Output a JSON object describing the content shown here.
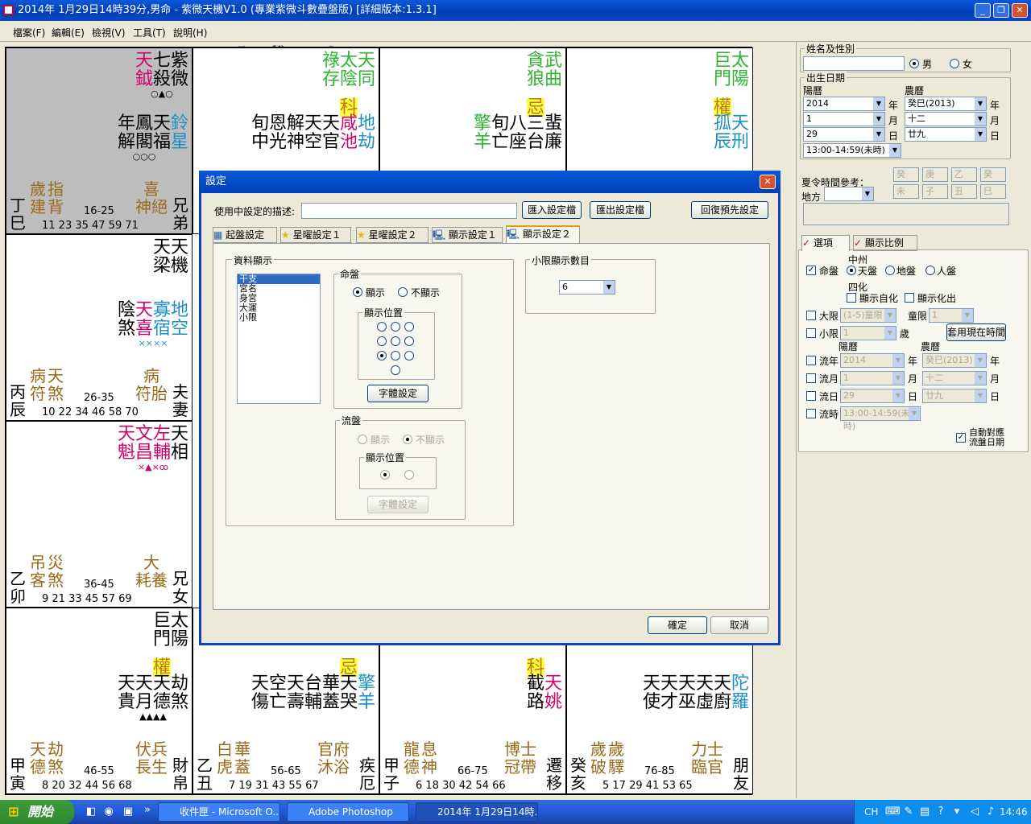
{
  "window": {
    "title": "2014年 1月29日14時39分,男命 - 紫微天機V1.0 (專業紫微斗數疊盤版) [詳細版本:1.3.1]"
  },
  "menu": [
    "檔案(F)",
    "編輯(E)",
    "檢視(V)",
    "工具(T)",
    "說明(H)"
  ],
  "palaces": [
    {
      "id": "si",
      "stem": "丁巳",
      "palace": "兄弟",
      "age": "16-25",
      "years": "11 23 35 47 59 71",
      "main": [
        "紫微",
        "七殺"
      ],
      "main_marks": [
        "○",
        "▲"
      ],
      "aux_top": [
        "天鉞"
      ],
      "aux_top_marks": [
        "○"
      ],
      "minor": [
        "鈴星",
        "天福",
        "鳳閣",
        "年解"
      ],
      "minor_marks": [
        "○",
        "○",
        "○"
      ],
      "bottom": [
        "兄弟"
      ],
      "cs": [
        "喜神",
        "絕"
      ],
      "cs2": [
        "歲建",
        "指背"
      ]
    },
    {
      "id": "wu",
      "stem": "",
      "palace": "",
      "main": [
        "天同",
        "太陰",
        "祿存"
      ],
      "main_marks": [
        "×",
        "○",
        ""
      ],
      "hua": "科",
      "minor": [
        "地劫",
        "咸池",
        "天官",
        "天空",
        "解神",
        "恩光",
        "旬中"
      ]
    },
    {
      "id": "wei",
      "main": [
        "武曲",
        "貪狼"
      ],
      "main_marks": [
        "○",
        "○"
      ],
      "hua": "忌",
      "minor": [
        "蜚廉",
        "三台",
        "八座",
        "旬亡",
        "擎羊"
      ]
    },
    {
      "id": "shen",
      "main": [
        "太陽",
        "巨門"
      ],
      "main_marks": [
        "×",
        "○"
      ],
      "hua": "權",
      "minor": [
        "天刑",
        "孤辰"
      ]
    }
  ],
  "cells": {
    "c00": {
      "stars_r": [
        "紫微",
        "七殺"
      ],
      "aux": "天鉞",
      "mk_top": "○▲○",
      "minor": [
        [
          "鈴",
          "星"
        ],
        [
          "天",
          "福"
        ],
        [
          "鳳",
          "閣"
        ],
        [
          "年",
          "解"
        ]
      ],
      "mk_mid": "○○○",
      "stem": [
        "丁",
        "巳"
      ],
      "cs1": [
        "喜",
        "神",
        "絕"
      ],
      "cs2": [
        "歲",
        "建"
      ],
      "cs3": [
        "指",
        "背"
      ],
      "age": "16-25",
      "years": "11 23 35 47 59 71",
      "palace": [
        "兄",
        "弟"
      ]
    },
    "c01": {
      "m1": [
        "天",
        "同"
      ],
      "m2": [
        "太",
        "陰"
      ],
      "m3": [
        "祿",
        "存"
      ],
      "hua": "科",
      "minor": [
        [
          "地",
          "劫"
        ],
        [
          "咸",
          "池"
        ],
        [
          "天",
          "官"
        ],
        [
          "天",
          "空"
        ],
        [
          "解",
          "神"
        ],
        [
          "恩",
          "光"
        ],
        [
          "旬",
          "中"
        ]
      ],
      "mk": "ꝏꝏꝏꝏꝏ×○"
    },
    "c02": {
      "m1": [
        "武",
        "曲"
      ],
      "m2": [
        "貪",
        "狼"
      ],
      "hua": "忌",
      "minor": [
        [
          "蜚",
          "廉"
        ],
        [
          "三",
          "台"
        ],
        [
          "八",
          "座"
        ],
        [
          "旬",
          "亡"
        ],
        [
          "擎",
          "羊"
        ]
      ],
      "mk": "×▲×ꝏ"
    },
    "c03": {
      "m1": [
        "太",
        "陽"
      ],
      "m2": [
        "巨",
        "門"
      ],
      "hua": "權",
      "minor": [
        [
          "天",
          "刑"
        ],
        [
          "孤",
          "辰"
        ]
      ],
      "mk": "×▲"
    },
    "c10": {
      "m1": [
        "天",
        "機"
      ],
      "m2": [
        "天",
        "梁"
      ],
      "minor": [
        [
          "地",
          "空"
        ],
        [
          "寡",
          "宿"
        ],
        [
          "天",
          "喜"
        ],
        [
          "陰",
          "煞"
        ]
      ],
      "mk": "××××",
      "stem": [
        "丙",
        "辰"
      ],
      "cs1": [
        "病",
        "符",
        "胎"
      ],
      "cs2": [
        "病",
        "符"
      ],
      "cs3": [
        "天",
        "煞"
      ],
      "age": "26-35",
      "years": "10 22 34 46 58 70",
      "palace": [
        "夫",
        "妻"
      ]
    },
    "c20": {
      "m1": [
        "天",
        "相"
      ],
      "m2": [
        "左",
        "輔"
      ],
      "m3": [
        "文",
        "昌"
      ],
      "m4": [
        "天",
        "魁"
      ],
      "mk": "×▲×ꝏ",
      "stem": [
        "乙",
        "卯"
      ],
      "cs1": [
        "大",
        "耗",
        "養"
      ],
      "cs2": [
        "吊",
        "客"
      ],
      "cs3": [
        "災",
        "煞"
      ],
      "age": "36-45",
      "years": "9 21 33 45 57 69",
      "palace": [
        "兄",
        "女"
      ]
    },
    "c30": {
      "m1": [
        "太",
        "陽"
      ],
      "m2": [
        "巨",
        "門"
      ],
      "hua": "權",
      "minor": [
        [
          "劫",
          "煞"
        ],
        [
          "天",
          "德"
        ],
        [
          "天",
          "月"
        ],
        [
          "天",
          "貴"
        ]
      ],
      "mk": "▲▲▲▲",
      "stem": [
        "甲",
        "寅"
      ],
      "cs1": [
        "伏",
        "兵",
        "長",
        "生"
      ],
      "cs2": [
        "天",
        "德"
      ],
      "cs3": [
        "劫",
        "煞"
      ],
      "age": "46-55",
      "years": "8 20 32 44 56 68",
      "palace": [
        "財",
        "帛"
      ]
    },
    "c31": {
      "hua": "忌",
      "minor": [
        [
          "擎",
          "羊"
        ],
        [
          "天",
          "哭"
        ],
        [
          "華",
          "蓋"
        ],
        [
          "台",
          "輔"
        ],
        [
          "天",
          "壽"
        ],
        [
          "空",
          "亡"
        ],
        [
          "天",
          "傷"
        ]
      ],
      "stem": [
        "乙",
        "丑"
      ],
      "cs1": [
        "官",
        "府",
        "沐",
        "浴"
      ],
      "cs2": [
        "白",
        "虎"
      ],
      "cs3": [
        "華",
        "蓋"
      ],
      "age": "56-65",
      "years": "7 19 31 43 55 67",
      "palace": [
        "疾",
        "厄"
      ]
    },
    "c32": {
      "hua": "科",
      "minor": [
        [
          "天",
          "姚"
        ],
        [
          "截",
          "路"
        ]
      ],
      "stem": [
        "甲",
        "子"
      ],
      "cs1": [
        "博",
        "士",
        "冠",
        "帶"
      ],
      "cs2": [
        "龍",
        "德"
      ],
      "cs3": [
        "息",
        "神"
      ],
      "age": "66-75",
      "years": "6 18 30 42 54 66",
      "palace": [
        "遷",
        "移"
      ]
    },
    "c33": {
      "minor": [
        [
          "陀",
          "羅"
        ],
        [
          "天",
          "廚"
        ],
        [
          "天",
          "虛"
        ],
        [
          "天",
          "巫"
        ],
        [
          "天",
          "才"
        ],
        [
          "天",
          "使"
        ]
      ],
      "stem": [
        "癸",
        "亥"
      ],
      "cs1": [
        "力",
        "士",
        "臨",
        "官"
      ],
      "cs2": [
        "歲",
        "破"
      ],
      "cs3": [
        "歲",
        "驛"
      ],
      "age": "76-85",
      "years": "5 17 29 41 53 65",
      "palace": [
        "朋",
        "友"
      ]
    }
  },
  "right": {
    "name_group": "姓名及性別",
    "male": "男",
    "female": "女",
    "birth_group": "出生日期",
    "solar": "陽曆",
    "lunar": "農曆",
    "s_year": "2014",
    "s_month": "1",
    "s_day": "29",
    "l_year": "癸巳(2013)",
    "l_month": "十二",
    "l_day": "廿九",
    "y": "年",
    "m": "月",
    "d": "日",
    "hour": "13:00-14:59(未時)",
    "dst": "夏令時間參考：",
    "place": "地方",
    "pillars": [
      "癸",
      "庚",
      "乙",
      "癸",
      "未",
      "子",
      "丑",
      "巳"
    ],
    "tab1": "選項",
    "tab2": "顯示比例",
    "mingpan": "命盤",
    "zhongzhou": "中州",
    "tianpan": "天盤",
    "dipan": "地盤",
    "renpan": "人盤",
    "sihua": "四化",
    "show_self": "顯示自化",
    "show_out": "顯示化出",
    "daxian": "大限",
    "daxian_val": "(1-5)童限",
    "tongxian": "童限",
    "tongxian_val": "1",
    "xiaoxian": "小限",
    "xiaoxian_val": "1",
    "sui": "歲",
    "use_now": "套用現在時間",
    "liunian": "流年",
    "liuyue": "流月",
    "liuri": "流日",
    "liushi": "流時",
    "ln_s": "2014",
    "ln_l": "癸巳(2013)",
    "ly_s": "1",
    "ly_l": "十二",
    "lr_s": "29",
    "lr_l": "廿九",
    "ls": "13:00-14:59(未時)",
    "auto": "自動對應流盤日期"
  },
  "dialog": {
    "title": "設定",
    "desc_label": "使用中設定的描述:",
    "desc_value": "",
    "import": "匯入設定檔",
    "export": "匯出設定檔",
    "restore": "回復預先設定",
    "tabs": [
      "起盤設定",
      "星曜設定１",
      "星曜設定２",
      "顯示設定１",
      "顯示設定２"
    ],
    "data_group": "資料顯示",
    "list": [
      "干支",
      "宮名",
      "身宮",
      "大運",
      "小限"
    ],
    "ming_group": "命盤",
    "show": "顯示",
    "noshow": "不顯示",
    "pos_group": "顯示位置",
    "font_btn": "字體設定",
    "liu_group": "流盤",
    "liu_show": "顯示",
    "liu_noshow": "不顯示",
    "liu_pos": "顯示位置",
    "liu_font": "字體設定",
    "xiao_group": "小限顯示數目",
    "xiao_val": "6",
    "ok": "確定",
    "cancel": "取消"
  },
  "taskbar": {
    "start": "開始",
    "tasks": [
      "收件匣 - Microsoft O...",
      "Adobe Photoshop",
      "2014年 1月29日14時..."
    ],
    "lang": "CH",
    "time": "14:46"
  }
}
